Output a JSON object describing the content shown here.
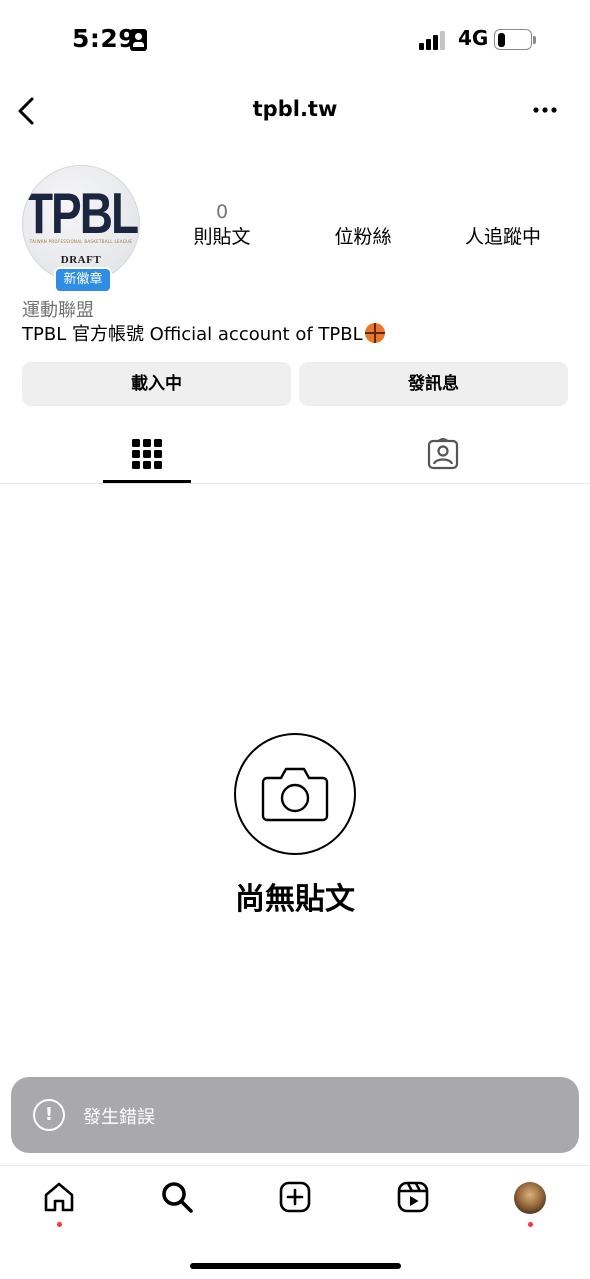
{
  "status_bar": {
    "time": "5:29",
    "network": "4G",
    "icons": [
      "id-card-icon",
      "signal-icon",
      "battery-icon"
    ]
  },
  "nav": {
    "username": "tpbl.tw",
    "back_icon": "chevron-left-icon",
    "more_icon": "more-horizontal-icon"
  },
  "profile": {
    "avatar": {
      "logo_text": "TPBL",
      "sub_text": "TAIWAN PROFESSIONAL BASKETBALL LEAGUE",
      "draft_text": "DRAFT",
      "badge": "新徽章"
    },
    "stats": [
      {
        "value": "0",
        "label": "則貼文"
      },
      {
        "value": "",
        "label": "位粉絲"
      },
      {
        "value": "",
        "label": "人追蹤中"
      }
    ],
    "category": "運動聯盟",
    "bio": "TPBL 官方帳號 Official account of TPBL",
    "bio_emoji": "basketball-icon"
  },
  "actions": {
    "follow_label": "載入中",
    "message_label": "發訊息"
  },
  "tabs": [
    {
      "name": "grid",
      "icon": "grid-icon",
      "active": true
    },
    {
      "name": "tagged",
      "icon": "tagged-person-icon",
      "active": false
    }
  ],
  "empty_state": {
    "icon": "camera-icon",
    "title": "尚無貼文"
  },
  "toast": {
    "icon": "alert-icon",
    "symbol": "!",
    "message": "發生錯誤"
  },
  "bottom_nav": [
    {
      "name": "home",
      "icon": "home-icon",
      "has_dot": true
    },
    {
      "name": "search",
      "icon": "search-icon",
      "has_dot": false
    },
    {
      "name": "create",
      "icon": "plus-square-icon",
      "has_dot": false
    },
    {
      "name": "reels",
      "icon": "reels-icon",
      "has_dot": false
    },
    {
      "name": "profile",
      "icon": "avatar-icon",
      "has_dot": true
    }
  ],
  "colors": {
    "accent_blue": "#2f8de4",
    "button_bg": "#efefef",
    "toast_bg": "#a9a9ab",
    "notification_dot": "#ff3040",
    "muted_text": "#737373"
  }
}
